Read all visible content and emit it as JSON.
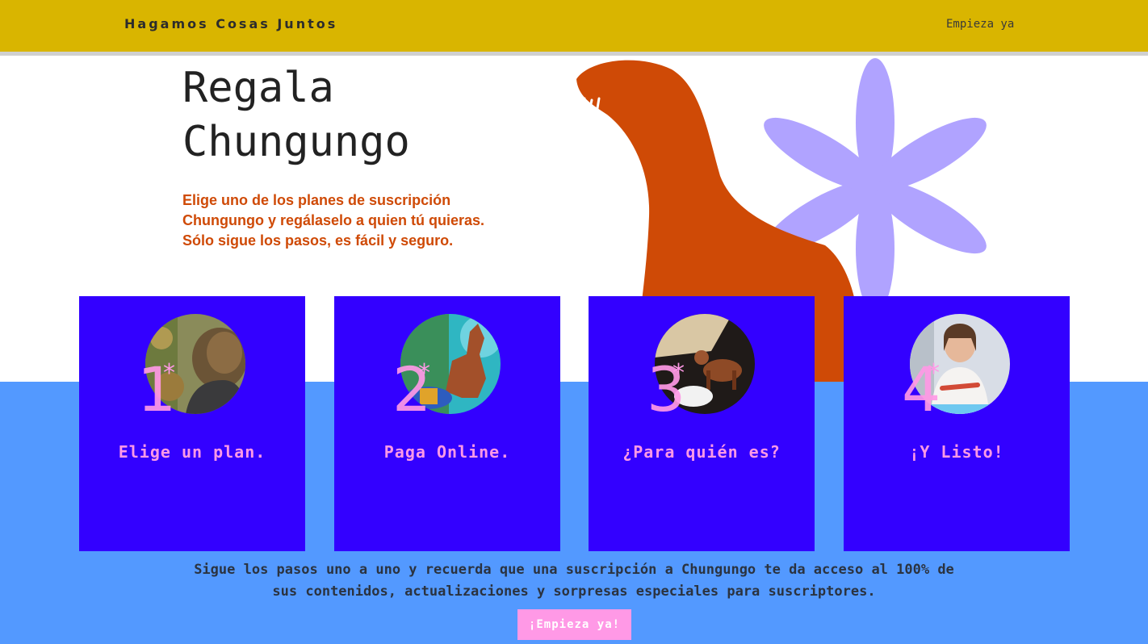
{
  "header": {
    "brand": "Hagamos Cosas Juntos",
    "nav_link": "Empieza ya"
  },
  "hero": {
    "title_line1": "Regala",
    "title_line2": "Chungungo",
    "desc_line1": "Elige uno de los planes de suscripción",
    "desc_line2": "Chungungo y regálaselo a quien tú quieras.",
    "desc_line3": "Sólo sigue los pasos, es fácil y seguro."
  },
  "steps": [
    {
      "number": "1",
      "star": "*",
      "label": "Elige un plan."
    },
    {
      "number": "2",
      "star": "*",
      "label": "Paga Online."
    },
    {
      "number": "3",
      "star": "*",
      "label": "¿Para quién es?"
    },
    {
      "number": "4",
      "star": "*",
      "label": "¡Y Listo!"
    }
  ],
  "footer": {
    "text_line1": "Sigue los pasos uno a uno y recuerda que una suscripción a Chungungo te da acceso al 100% de",
    "text_line2": "sus contenidos, actualizaciones y sorpresas especiales para suscriptores.",
    "cta_label": "¡Empieza ya!"
  },
  "colors": {
    "topbar": "#d9b500",
    "blue_band": "#5399ff",
    "card": "#3300ff",
    "accent_pink": "#ff99e6",
    "otter": "#cf4a06",
    "flower": "#b0a3ff"
  },
  "icons": {
    "otter": "otter-illustration",
    "flower": "flower-illustration"
  }
}
